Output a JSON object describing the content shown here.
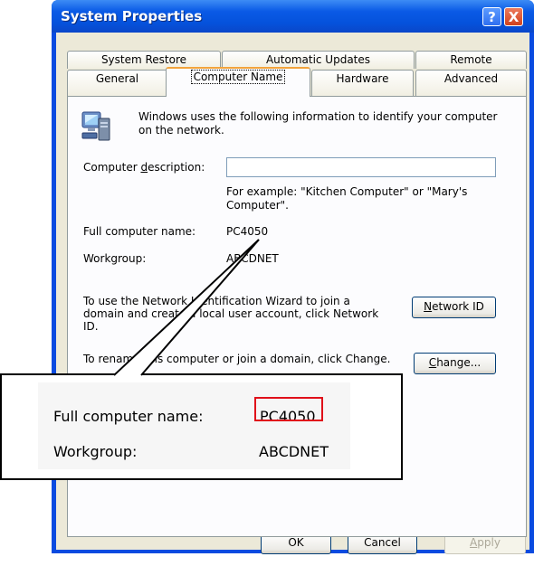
{
  "window": {
    "title": "System Properties",
    "help_label": "?",
    "close_label": "X"
  },
  "tabs": {
    "row1": [
      "System Restore",
      "Automatic Updates",
      "Remote"
    ],
    "row2": [
      "General",
      "Computer Name",
      "Hardware",
      "Advanced"
    ],
    "active": "Computer Name"
  },
  "panel": {
    "intro_line1": "Windows uses the following information to identify your computer",
    "intro_line2": "on the network.",
    "description_label_pre": "Computer ",
    "description_label_u": "d",
    "description_label_post": "escription:",
    "description_value": "",
    "example_line1": "For example: \"Kitchen Computer\" or \"Mary's",
    "example_line2": "Computer\".",
    "full_name_label": "Full computer name:",
    "full_name_value": "PC4050",
    "workgroup_label": "Workgroup:",
    "workgroup_value": "ABCDNET",
    "network_text_line1": "To use the Network Identification Wizard to join a",
    "network_text_line2": "domain and create a local user account, click Network",
    "network_text_line3": "ID.",
    "network_btn_u": "N",
    "network_btn_rest": "etwork ID",
    "rename_text": "To rename this computer or join a domain, click Change.",
    "change_btn_u": "C",
    "change_btn_rest": "hange..."
  },
  "buttons": {
    "ok": "OK",
    "cancel": "Cancel",
    "apply_u": "A",
    "apply_rest": "pply"
  },
  "callout": {
    "full_name_label": "Full computer name:",
    "full_name_value": "PC4050",
    "workgroup_label": "Workgroup:",
    "workgroup_value": "ABCDNET",
    "highlight_color": "#e0101a"
  }
}
